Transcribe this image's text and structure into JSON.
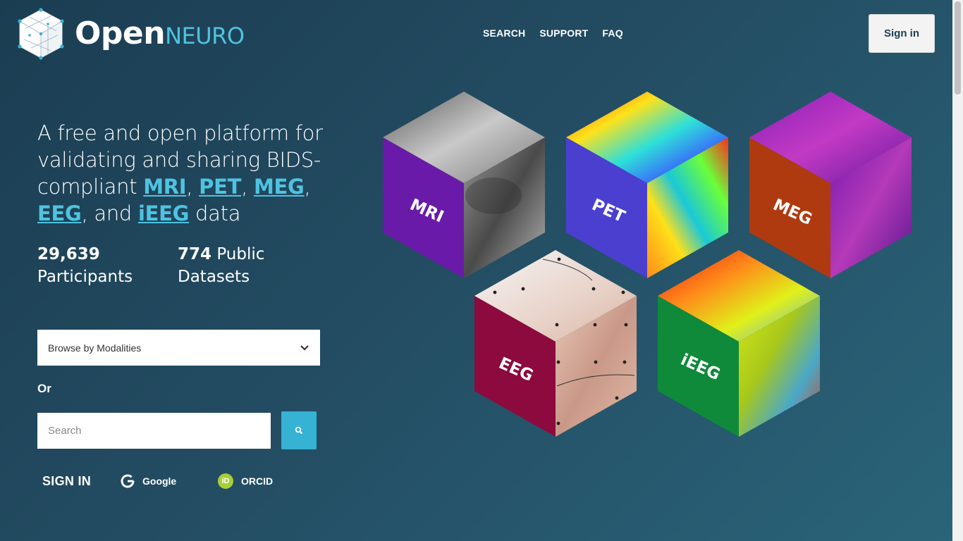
{
  "brand": {
    "open": "Open",
    "neuro": "NEURO"
  },
  "nav": {
    "items": [
      "SEARCH",
      "SUPPORT",
      "FAQ"
    ]
  },
  "header": {
    "signin_label": "Sign in"
  },
  "hero": {
    "text_1": "A free and open platform for validating and sharing BIDS-compliant ",
    "mri": "MRI",
    "sep_1": ", ",
    "pet": "PET",
    "sep_2": ", ",
    "meg": "MEG",
    "sep_3": ", ",
    "eeg": "EEG",
    "sep_4": ", and ",
    "ieeg": "iEEG",
    "text_end": " data"
  },
  "stats": {
    "participants_value": "29,639",
    "participants_label": "Participants",
    "datasets_value": "774",
    "datasets_label_1": "Public",
    "datasets_label_2": "Datasets"
  },
  "browse": {
    "label": "Browse by Modalities"
  },
  "or_label": "Or",
  "search": {
    "placeholder": "Search",
    "value": ""
  },
  "signin": {
    "label": "SIGN IN",
    "google": "Google",
    "orcid": "ORCID",
    "orcid_badge": "iD"
  },
  "cubes": {
    "mri": "MRI",
    "pet": "PET",
    "meg": "MEG",
    "eeg": "EEG",
    "ieeg": "iEEG"
  },
  "colors": {
    "accent": "#4fc3e0",
    "search_button": "#35b2d4",
    "mri_face": "#6a1aa8",
    "pet_face": "#4b3fd0",
    "meg_face": "#b03a10",
    "eeg_face": "#8c0a3e",
    "ieeg_face": "#0f8a3a",
    "orcid": "#a6ce39"
  }
}
